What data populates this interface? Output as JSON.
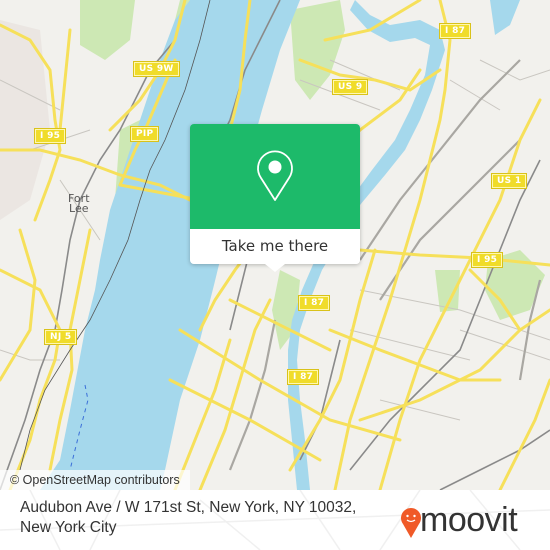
{
  "map": {
    "attribution": "© OpenStreetMap contributors",
    "colors": {
      "land": "#f2f1ed",
      "water": "#a5d8ec",
      "park": "#cde8b4",
      "road": "#f6e05a",
      "road_minor": "#c9c6c0",
      "rail": "#777777",
      "shield": "#f0dc2a"
    },
    "shields": [
      {
        "label": "US 9W"
      },
      {
        "label": "PIP"
      },
      {
        "label": "I 95"
      },
      {
        "label": "US 9"
      },
      {
        "label": "I 87"
      },
      {
        "label": "US 1"
      },
      {
        "label": "I 95"
      },
      {
        "label": "I 87"
      },
      {
        "label": "I 87"
      },
      {
        "label": "NJ 5"
      }
    ],
    "places": [
      {
        "label": "Fort\nLee"
      }
    ]
  },
  "popup": {
    "action_label": "Take me there",
    "icon": "map-pin-icon",
    "color": "#1dba6a"
  },
  "footer": {
    "address_line1": "Audubon Ave / W 171st St, New York, NY 10032,",
    "address_line2": "New York City",
    "brand": "moovit",
    "brand_color": "#f05a28"
  }
}
